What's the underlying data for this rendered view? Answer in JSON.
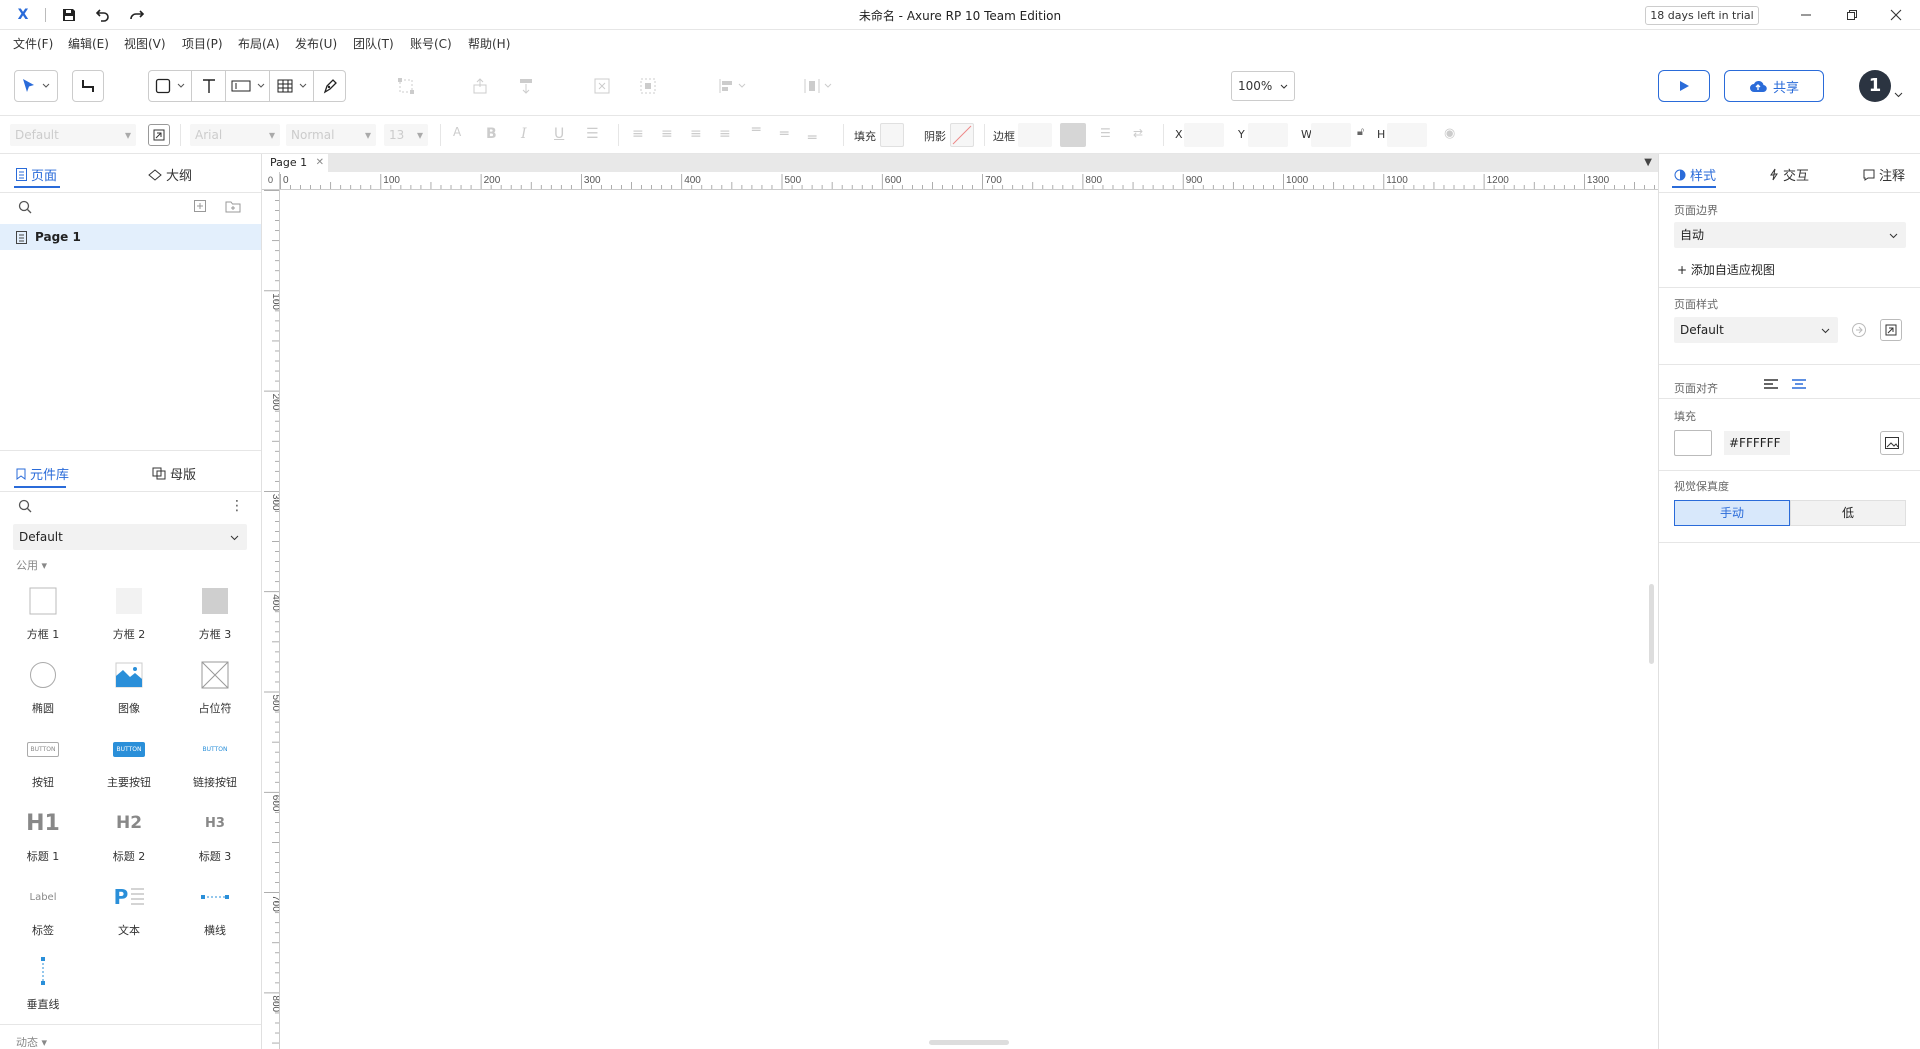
{
  "title_bar": {
    "logo": "X",
    "title": "未命名 - Axure RP 10 Team Edition",
    "trial_badge": "18 days left in trial"
  },
  "menu": [
    "文件(F)",
    "编辑(E)",
    "视图(V)",
    "项目(P)",
    "布局(A)",
    "发布(U)",
    "团队(T)",
    "账号(C)",
    "帮助(H)"
  ],
  "toolbar": {
    "zoom": "100%",
    "share_label": "共享",
    "avatar": "1"
  },
  "format_bar": {
    "style_placeholder": "Default",
    "font_placeholder": "Arial",
    "weight_placeholder": "Normal",
    "size_placeholder": "13",
    "fill_label": "填充",
    "shadow_label": "阴影",
    "border_label": "边框",
    "x_label": "X",
    "y_label": "Y",
    "w_label": "W",
    "h_label": "H"
  },
  "left_panel": {
    "tab_pages": "页面",
    "tab_outline": "大纲",
    "pages": [
      "Page 1"
    ],
    "tab_library": "元件库",
    "tab_masters": "母版",
    "library_select": "Default",
    "group_common": "公用",
    "group_dynamic": "动态",
    "widgets": [
      {
        "label": "方框 1",
        "icon": "box1-icon"
      },
      {
        "label": "方框 2",
        "icon": "box2-icon"
      },
      {
        "label": "方框 3",
        "icon": "box3-icon"
      },
      {
        "label": "椭圆",
        "icon": "ellipse-icon"
      },
      {
        "label": "图像",
        "icon": "image-icon"
      },
      {
        "label": "占位符",
        "icon": "placeholder-icon"
      },
      {
        "label": "按钮",
        "icon": "button-icon",
        "glyph": "BUTTON"
      },
      {
        "label": "主要按钮",
        "icon": "primary-button-icon",
        "glyph": "BUTTON"
      },
      {
        "label": "链接按钮",
        "icon": "link-button-icon",
        "glyph": "BUTTON"
      },
      {
        "label": "标题 1",
        "icon": "heading1-icon",
        "glyph": "H1"
      },
      {
        "label": "标题 2",
        "icon": "heading2-icon",
        "glyph": "H2"
      },
      {
        "label": "标题 3",
        "icon": "heading3-icon",
        "glyph": "H3"
      },
      {
        "label": "标签",
        "icon": "label-icon",
        "glyph": "Label"
      },
      {
        "label": "文本",
        "icon": "paragraph-icon",
        "glyph": "P"
      },
      {
        "label": "横线",
        "icon": "horizontal-line-icon"
      },
      {
        "label": "垂直线",
        "icon": "vertical-line-icon"
      }
    ]
  },
  "canvas": {
    "page_tab": "Page 1",
    "ruler_corner": "0",
    "ruler_h": [
      "0",
      "100",
      "200",
      "300",
      "400",
      "500",
      "600",
      "700",
      "800",
      "900",
      "1000",
      "1100",
      "1200",
      "1300"
    ],
    "ruler_v": [
      "100",
      "200",
      "300",
      "400",
      "500",
      "600",
      "700",
      "800"
    ]
  },
  "right_panel": {
    "tab_style": "样式",
    "tab_interaction": "交互",
    "tab_notes": "注释",
    "page_bounds_label": "页面边界",
    "page_bounds_value": "自动",
    "add_adaptive": "+ 添加自适应视图",
    "page_style_label": "页面样式",
    "page_style_value": "Default",
    "page_align_label": "页面对齐",
    "fill_label": "填充",
    "fill_hex": "#FFFFFF",
    "fidelity_label": "视觉保真度",
    "fidelity_manual": "手动",
    "fidelity_low": "低"
  },
  "colors": {
    "accent": "#2a6bd9",
    "selected_bg": "#e3effc",
    "avatar_bg": "#2b3441"
  }
}
